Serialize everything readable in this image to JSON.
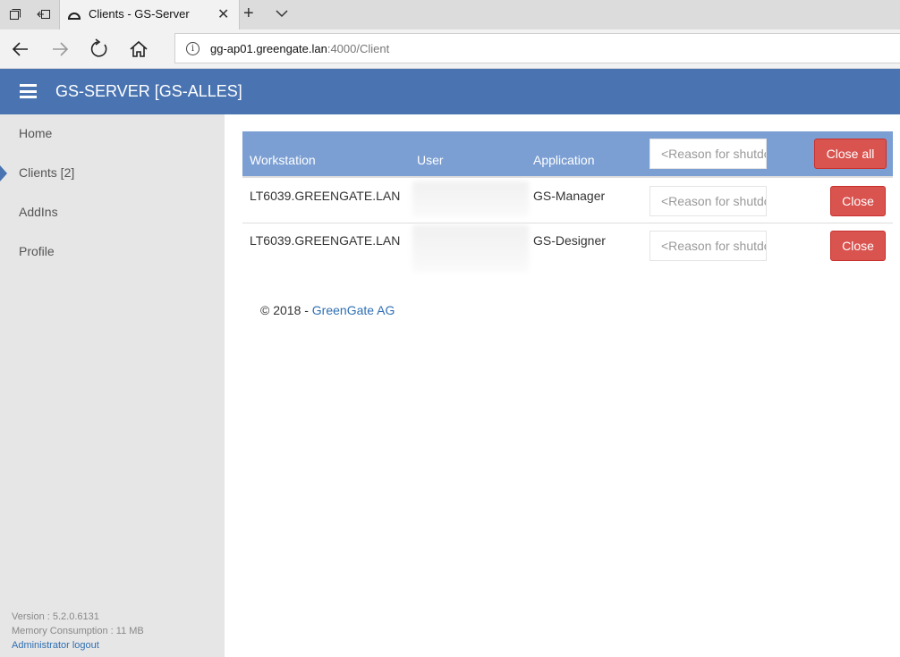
{
  "browser": {
    "tab_title": "Clients - GS-Server",
    "address": {
      "host": "gg-ap01.greengate.lan",
      "path": ":4000/Client"
    }
  },
  "app": {
    "title": "GS-SERVER [GS-ALLES]"
  },
  "sidebar": {
    "items": [
      {
        "label": "Home"
      },
      {
        "label": "Clients [2]"
      },
      {
        "label": "AddIns"
      },
      {
        "label": "Profile"
      }
    ],
    "version": "Version : 5.2.0.6131",
    "memory": "Memory Consumption : 11 MB",
    "logout": "Administrator logout"
  },
  "table": {
    "headers": {
      "workstation": "Workstation",
      "user": "User",
      "application": "Application"
    },
    "reason_placeholder": "<Reason for shutdown>",
    "close_all_label": "Close all",
    "close_label": "Close",
    "rows": [
      {
        "workstation": "LT6039.GREENGATE.LAN",
        "application": "GS-Manager"
      },
      {
        "workstation": "LT6039.GREENGATE.LAN",
        "application": "GS-Designer"
      }
    ]
  },
  "footer": {
    "copyright": "© 2018 -",
    "company": "GreenGate AG"
  },
  "colors": {
    "brand": "#4a74b1",
    "table_header": "#7b9fd3",
    "danger": "#d9534f",
    "link": "#2f6fb3"
  }
}
